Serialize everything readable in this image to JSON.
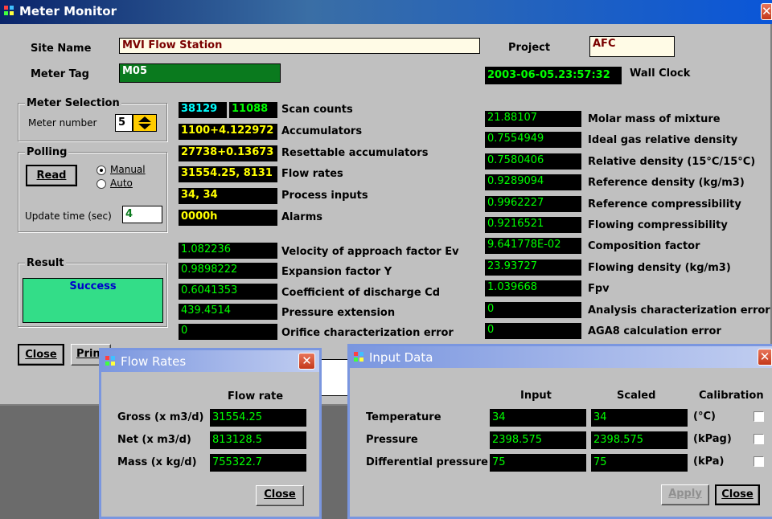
{
  "main_window": {
    "title": "Meter Monitor",
    "site_name_label": "Site Name",
    "site_name_value": "MVI Flow Station",
    "project_label": "Project",
    "project_value": "AFC",
    "meter_tag_label": "Meter Tag",
    "meter_tag_value": "M05",
    "wall_clock_value": "2003-06-05.23:57:32",
    "wall_clock_label": "Wall Clock",
    "meter_selection": {
      "title": "Meter Selection",
      "meter_number_label": "Meter number",
      "meter_number_value": "5"
    },
    "polling": {
      "title": "Polling",
      "read_button": "Read",
      "manual_label": "Manual",
      "auto_label": "Auto",
      "update_time_label": "Update time (sec)",
      "update_time_value": "4"
    },
    "result": {
      "title": "Result",
      "value": "Success"
    },
    "counters": [
      {
        "values": [
          "38129",
          "11088"
        ],
        "label": "Scan counts"
      },
      {
        "values": [
          "1100+4.122972"
        ],
        "label": "Accumulators"
      },
      {
        "values": [
          "27738+0.13673"
        ],
        "label": "Resettable accumulators"
      },
      {
        "values": [
          "31554.25, 8131"
        ],
        "label": "Flow rates"
      },
      {
        "values": [
          "34, 34"
        ],
        "label": "Process inputs"
      },
      {
        "values": [
          "0000h"
        ],
        "label": "Alarms"
      }
    ],
    "orifice_values": [
      {
        "value": "1.082236",
        "label": "Velocity of approach factor Ev"
      },
      {
        "value": "0.9898222",
        "label": "Expansion factor Y"
      },
      {
        "value": "0.6041353",
        "label": "Coefficient of discharge Cd"
      },
      {
        "value": "439.4514",
        "label": "Pressure extension"
      },
      {
        "value": "0",
        "label": "Orifice characterization error"
      }
    ],
    "gas_values": [
      {
        "value": "21.88107",
        "label": "Molar mass of mixture"
      },
      {
        "value": "0.7554949",
        "label": "Ideal gas relative density"
      },
      {
        "value": "0.7580406",
        "label": "Relative density (15°C/15°C)"
      },
      {
        "value": "0.9289094",
        "label": "Reference density (kg/m3)"
      },
      {
        "value": "0.9962227",
        "label": "Reference compressibility"
      },
      {
        "value": "0.9216521",
        "label": "Flowing compressibility"
      },
      {
        "value": "9.641778E-02",
        "label": "Composition factor"
      },
      {
        "value": "23.93727",
        "label": "Flowing density (kg/m3)"
      },
      {
        "value": "1.039668",
        "label": "Fpv"
      },
      {
        "value": "0",
        "label": "Analysis characterization error"
      },
      {
        "value": "0",
        "label": "AGA8 calculation error"
      }
    ],
    "close_button": "Close",
    "print_button": "Prin"
  },
  "flow_rates_window": {
    "title": "Flow Rates",
    "column_header": "Flow rate",
    "rows": [
      {
        "label": "Gross (x m3/d)",
        "value": "31554.25"
      },
      {
        "label": "Net (x m3/d)",
        "value": "813128.5"
      },
      {
        "label": "Mass (x kg/d)",
        "value": "755322.7"
      }
    ],
    "close_button": "Close"
  },
  "input_data_window": {
    "title": "Input Data",
    "headers": {
      "input": "Input",
      "scaled": "Scaled",
      "calibration": "Calibration"
    },
    "rows": [
      {
        "label": "Temperature",
        "input": "34",
        "scaled": "34",
        "unit": "(°C)"
      },
      {
        "label": "Pressure",
        "input": "2398.575",
        "scaled": "2398.575",
        "unit": "(kPag)"
      },
      {
        "label": "Differential pressure",
        "input": "75",
        "scaled": "75",
        "unit": "(kPa)"
      }
    ],
    "apply_button": "Apply",
    "close_button": "Close"
  },
  "colors": {
    "window_bg": "#c0c0c0",
    "value_bg": "#000000",
    "value_green": "#00ff00",
    "value_yellow": "#ffff00",
    "value_cyan": "#00ffff",
    "result_bg": "#33dd88"
  }
}
